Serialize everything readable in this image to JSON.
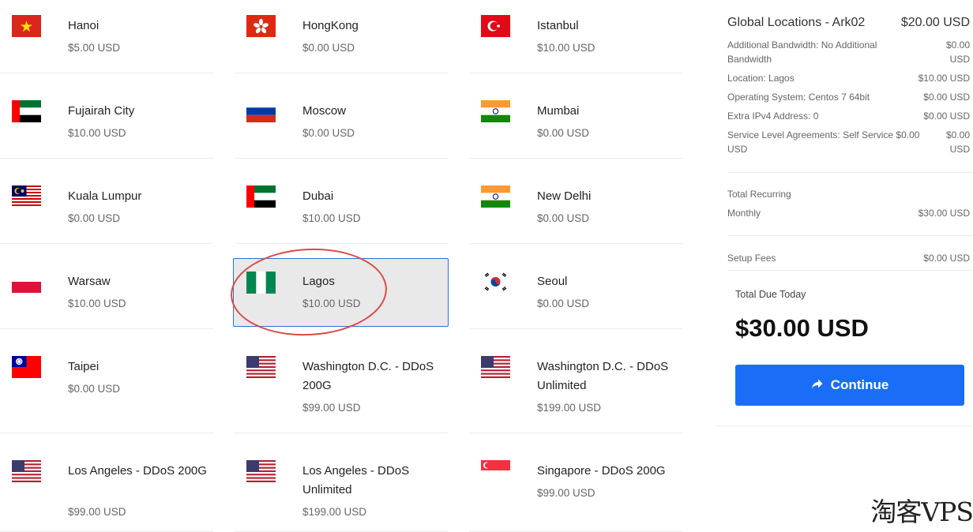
{
  "locations": [
    {
      "name": "Hanoi",
      "price": "$5.00 USD",
      "flag": "vietnam"
    },
    {
      "name": "HongKong",
      "price": "$0.00 USD",
      "flag": "hongkong"
    },
    {
      "name": "Istanbul",
      "price": "$10.00 USD",
      "flag": "turkey"
    },
    {
      "name": "Fujairah City",
      "price": "$10.00 USD",
      "flag": "uae"
    },
    {
      "name": "Moscow",
      "price": "$0.00 USD",
      "flag": "russia"
    },
    {
      "name": "Mumbai",
      "price": "$0.00 USD",
      "flag": "india"
    },
    {
      "name": "Kuala Lumpur",
      "price": "$0.00 USD",
      "flag": "malaysia"
    },
    {
      "name": "Dubai",
      "price": "$10.00 USD",
      "flag": "uae"
    },
    {
      "name": "New Delhi",
      "price": "$0.00 USD",
      "flag": "india"
    },
    {
      "name": "Warsaw",
      "price": "$10.00 USD",
      "flag": "poland"
    },
    {
      "name": "Lagos",
      "price": "$10.00 USD",
      "flag": "nigeria",
      "selected": true
    },
    {
      "name": "Seoul",
      "price": "$0.00 USD",
      "flag": "korea"
    },
    {
      "name": "Taipei",
      "price": "$0.00 USD",
      "flag": "taiwan"
    },
    {
      "name": "Washington D.C. - DDoS 200G",
      "price": "$99.00 USD",
      "flag": "usa"
    },
    {
      "name": "Washington D.C. - DDoS Unlimited",
      "price": "$199.00 USD",
      "flag": "usa"
    },
    {
      "name": "Los Angeles - DDoS 200G",
      "price": "$99.00 USD",
      "flag": "usa"
    },
    {
      "name": "Los Angeles - DDoS Unlimited",
      "price": "$199.00 USD",
      "flag": "usa"
    },
    {
      "name": "Singapore - DDoS 200G",
      "price": "$99.00 USD",
      "flag": "singapore"
    }
  ],
  "summary": {
    "title": "Global Locations - Ark02",
    "base_price": "$20.00 USD",
    "items": [
      {
        "label": "Additional Bandwidth: No Additional Bandwidth",
        "amount": "$0.00 USD"
      },
      {
        "label": "Location: Lagos",
        "amount": "$10.00 USD"
      },
      {
        "label": "Operating System: Centos 7 64bit",
        "amount": "$0.00 USD"
      },
      {
        "label": "Extra IPv4 Address: 0",
        "amount": "$0.00 USD"
      },
      {
        "label": "Service Level Agreements: Self Service $0.00 USD",
        "amount": "$0.00 USD"
      }
    ],
    "recurring_label": "Total Recurring",
    "recurring_period": "Monthly",
    "recurring_amount": "$30.00 USD",
    "setup_label": "Setup Fees",
    "setup_amount": "$0.00 USD",
    "due_label": "Total Due Today",
    "due_amount": "$30.00 USD",
    "continue_label": "Continue"
  },
  "watermark": "淘客VPS",
  "colors": {
    "accent": "#1a6ef5",
    "selected_border": "#2f6fd6",
    "highlight_circle": "#d94b45"
  }
}
